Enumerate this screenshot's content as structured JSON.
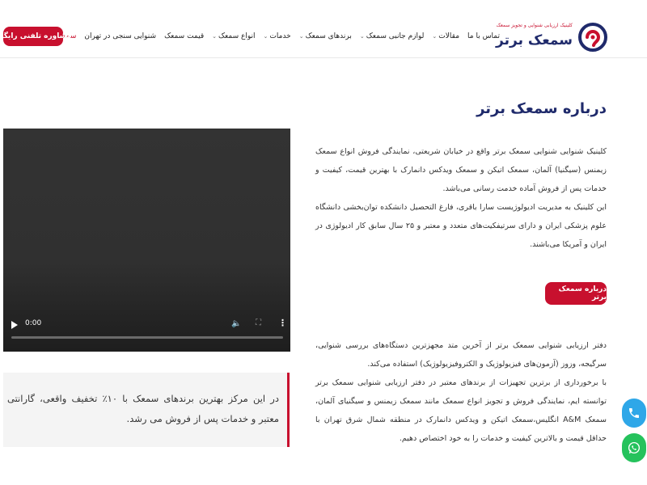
{
  "brand": {
    "name": "سمعک برتر",
    "tagline": "کلینیک ارزیابی شنوایی و تجویز سمعک",
    "primary_color": "#c8102e",
    "navy_color": "#1f2a6b"
  },
  "nav": {
    "items": [
      {
        "label": "سمعک برتر",
        "has_dropdown": true,
        "active": true
      },
      {
        "label": "شنوایی سنجی در تهران",
        "has_dropdown": false,
        "active": false
      },
      {
        "label": "قیمت سمعک",
        "has_dropdown": false,
        "active": false
      },
      {
        "label": "انواع سمعک",
        "has_dropdown": true,
        "active": false
      },
      {
        "label": "خدمات",
        "has_dropdown": true,
        "active": false
      },
      {
        "label": "برندهای سمعک",
        "has_dropdown": true,
        "active": false
      },
      {
        "label": "لوازم جانبی سمعک",
        "has_dropdown": true,
        "active": false
      },
      {
        "label": "مقالات",
        "has_dropdown": true,
        "active": false
      },
      {
        "label": "تماس با ما",
        "has_dropdown": false,
        "active": false
      }
    ],
    "cta_label": "مشاوره تلفنی رایگان"
  },
  "about": {
    "title": "درباره سمعک برتر",
    "paragraph1": "کلینیک شنوایی شنوایی سمعک برتر واقع در خیابان شریعتی، نمایندگی فروش انواع سمعک زیمنس (سیگنیا) آلمان، سمعک اتیکن و سمعک ویدکس دانمارک با بهترین قیمت، کیفیت و خدمات پس از فروش آماده خدمت رسانی می‌باشد.",
    "paragraph2": "این کلینیک به مدیریت ادیولوژیست سارا باقری، فارغ التحصیل دانشکده توان‌بخشی دانشگاه علوم پزشکی ایران و دارای سرتیفکیت‌های متعدد و معتبر و ۲۵ سال سابق کار ادیولوژی در ایران و آمریکا می‌باشند.",
    "button_label": "درباره سمعک برتر",
    "paragraph3": "دفتر ارزیابی شنوایی سمعک برتر از آخرین متد مجهزترین دستگاه‌های بررسی شنوایی، سرگیجه، وزوز (آزمون‌های فیزیولوژیک و الکتروفیزیولوژیک) استفاده می‌کند.",
    "paragraph4": "با برخورداری از برترین تجهیزات از برندهای معتبر در دفتر ارزیابی شنوایی سمعک برتر توانسته ایم، نمایندگی فروش و تجویز انواع سمعک مانند سمعک زیمنس و سیگنیای آلمان، سمعک A&M انگلیس،سمعک اتیکن و ویدکس دانمارک در منطقه شمال شرق  تهران با حداقل قیمت و بالاترین کیفیت و خدمات را به خود اختصاص دهیم."
  },
  "video": {
    "time": "0:00",
    "progress": 0
  },
  "promo": {
    "text": "در این مرکز بهترین برندهای سمعک با ۱۰٪ تخفیف واقعی، گارانتی معتبر و خدمات پس از فروش می رشد."
  },
  "icons": {
    "phone": "phone-icon",
    "whatsapp": "whatsapp-icon",
    "phone_color": "#2ea7e8",
    "whatsapp_color": "#25c25c"
  }
}
